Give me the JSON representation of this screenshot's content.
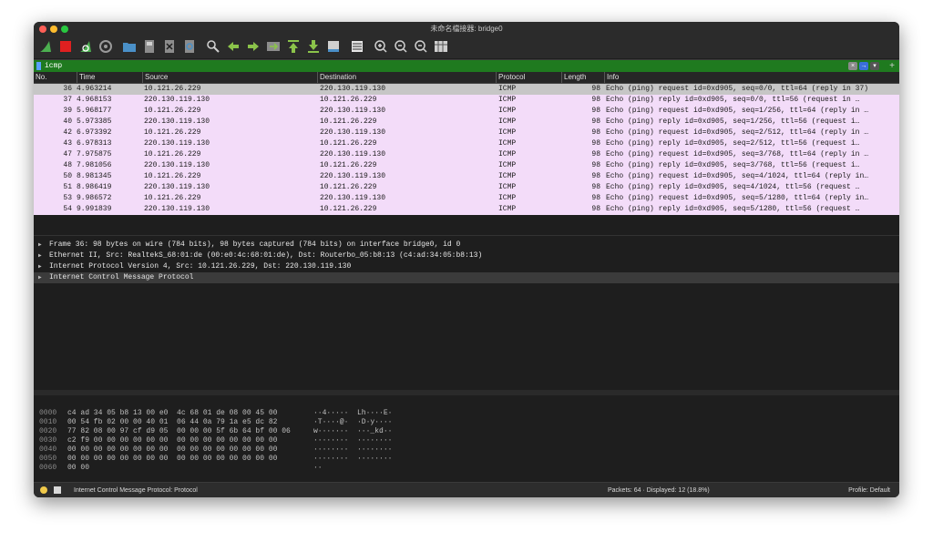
{
  "window": {
    "title": "未命名檔接器: bridge0"
  },
  "toolbar": {
    "icons": [
      "shark-fin-start-icon",
      "stop-capture-icon",
      "restart-capture-icon",
      "capture-options-gear-icon",
      "open-file-folder-icon",
      "save-file-icon",
      "close-file-icon",
      "reload-file-icon",
      "find-packet-icon",
      "go-back-arrow-icon",
      "go-forward-arrow-icon",
      "go-to-packet-icon",
      "go-to-first-packet-icon",
      "go-to-last-packet-icon",
      "auto-scroll-icon",
      "colorize-icon",
      "zoom-in-icon",
      "zoom-out-icon",
      "zoom-normal-icon",
      "resize-columns-icon"
    ]
  },
  "filter": {
    "value": "icmp"
  },
  "packet_list": {
    "headers": [
      "No.",
      "Time",
      "Source",
      "Destination",
      "Protocol",
      "Length",
      "Info"
    ],
    "rows": [
      {
        "no": "36",
        "time": "4.963214",
        "src": "10.121.26.229",
        "dst": "220.130.119.130",
        "proto": "ICMP",
        "len": "98",
        "info": "Echo (ping) request  id=0xd905, seq=0/0, ttl=64 (reply in 37)"
      },
      {
        "no": "37",
        "time": "4.968153",
        "src": "220.130.119.130",
        "dst": "10.121.26.229",
        "proto": "ICMP",
        "len": "98",
        "info": "Echo (ping) reply    id=0xd905, seq=0/0, ttl=56 (request in …"
      },
      {
        "no": "39",
        "time": "5.968177",
        "src": "10.121.26.229",
        "dst": "220.130.119.130",
        "proto": "ICMP",
        "len": "98",
        "info": "Echo (ping) request  id=0xd905, seq=1/256, ttl=64 (reply in …"
      },
      {
        "no": "40",
        "time": "5.973385",
        "src": "220.130.119.130",
        "dst": "10.121.26.229",
        "proto": "ICMP",
        "len": "98",
        "info": "Echo (ping) reply    id=0xd905, seq=1/256, ttl=56 (request i…"
      },
      {
        "no": "42",
        "time": "6.973392",
        "src": "10.121.26.229",
        "dst": "220.130.119.130",
        "proto": "ICMP",
        "len": "98",
        "info": "Echo (ping) request  id=0xd905, seq=2/512, ttl=64 (reply in …"
      },
      {
        "no": "43",
        "time": "6.978313",
        "src": "220.130.119.130",
        "dst": "10.121.26.229",
        "proto": "ICMP",
        "len": "98",
        "info": "Echo (ping) reply    id=0xd905, seq=2/512, ttl=56 (request i…"
      },
      {
        "no": "47",
        "time": "7.975875",
        "src": "10.121.26.229",
        "dst": "220.130.119.130",
        "proto": "ICMP",
        "len": "98",
        "info": "Echo (ping) request  id=0xd905, seq=3/768, ttl=64 (reply in …"
      },
      {
        "no": "48",
        "time": "7.981056",
        "src": "220.130.119.130",
        "dst": "10.121.26.229",
        "proto": "ICMP",
        "len": "98",
        "info": "Echo (ping) reply    id=0xd905, seq=3/768, ttl=56 (request i…"
      },
      {
        "no": "50",
        "time": "8.981345",
        "src": "10.121.26.229",
        "dst": "220.130.119.130",
        "proto": "ICMP",
        "len": "98",
        "info": "Echo (ping) request  id=0xd905, seq=4/1024, ttl=64 (reply in…"
      },
      {
        "no": "51",
        "time": "8.986419",
        "src": "220.130.119.130",
        "dst": "10.121.26.229",
        "proto": "ICMP",
        "len": "98",
        "info": "Echo (ping) reply    id=0xd905, seq=4/1024, ttl=56 (request …"
      },
      {
        "no": "53",
        "time": "9.986572",
        "src": "10.121.26.229",
        "dst": "220.130.119.130",
        "proto": "ICMP",
        "len": "98",
        "info": "Echo (ping) request  id=0xd905, seq=5/1280, ttl=64 (reply in…"
      },
      {
        "no": "54",
        "time": "9.991839",
        "src": "220.130.119.130",
        "dst": "10.121.26.229",
        "proto": "ICMP",
        "len": "98",
        "info": "Echo (ping) reply    id=0xd905, seq=5/1280, ttl=56 (request …"
      }
    ]
  },
  "details": {
    "rows": [
      "Frame 36: 98 bytes on wire (784 bits), 98 bytes captured (784 bits) on interface bridge0, id 0",
      "Ethernet II, Src: RealtekS_68:01:de (00:e0:4c:68:01:de), Dst: Routerbo_05:b8:13 (c4:ad:34:05:b8:13)",
      "Internet Protocol Version 4, Src: 10.121.26.229, Dst: 220.130.119.130",
      "Internet Control Message Protocol"
    ]
  },
  "bytes": {
    "rows": [
      {
        "off": "0000",
        "hex": "c4 ad 34 05 b8 13 00 e0  4c 68 01 de 08 00 45 00",
        "asc": "··4·····  Lh····E·"
      },
      {
        "off": "0010",
        "hex": "00 54 fb 02 00 00 40 01  06 44 0a 79 1a e5 dc 82",
        "asc": "·T····@·  ·D·y····"
      },
      {
        "off": "0020",
        "hex": "77 82 08 00 97 cf d9 05  00 00 00 5f 6b 64 bf 00 06",
        "asc": "w·······  ···_kd··"
      },
      {
        "off": "0030",
        "hex": "c2 f9 00 00 00 00 00 00  00 00 00 00 00 00 00 00",
        "asc": "········  ········"
      },
      {
        "off": "0040",
        "hex": "00 00 00 00 00 00 00 00  00 00 00 00 00 00 00 00",
        "asc": "········  ········"
      },
      {
        "off": "0050",
        "hex": "00 00 00 00 00 00 00 00  00 00 00 00 00 00 00 00",
        "asc": "········  ········"
      },
      {
        "off": "0060",
        "hex": "00 00",
        "asc": "··"
      }
    ]
  },
  "status": {
    "text": "Internet Control Message Protocol: Protocol",
    "packets": "Packets: 64 · Displayed: 12 (18.8%)",
    "profile": "Profile: Default"
  },
  "colors": {
    "row_bg": "#f3dcf9",
    "selected_row_bg": "#c6c6c6",
    "filter_bg": "#1f7a1f"
  }
}
